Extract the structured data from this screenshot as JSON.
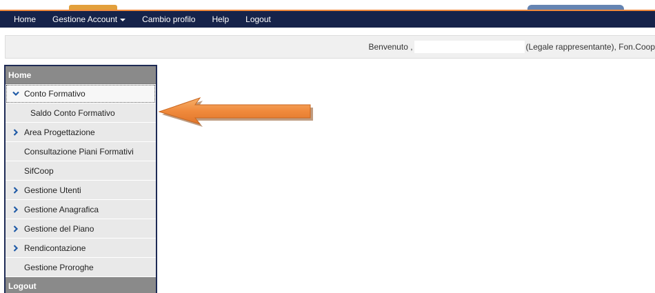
{
  "navbar": {
    "home": "Home",
    "account": "Gestione Account",
    "change_profile": "Cambio profilo",
    "help": "Help",
    "logout": "Logout"
  },
  "welcome": {
    "prefix": "Benvenuto ,",
    "suffix": "(Legale rappresentante), Fon.Coop"
  },
  "sidebar": {
    "home_header": "Home",
    "items": [
      {
        "label": "Conto Formativo",
        "expanded": true
      },
      {
        "label": "Saldo Conto Formativo"
      },
      {
        "label": "Area Progettazione"
      },
      {
        "label": "Consultazione Piani Formativi"
      },
      {
        "label": "SifCoop"
      },
      {
        "label": "Gestione Utenti"
      },
      {
        "label": "Gestione Anagrafica"
      },
      {
        "label": "Gestione del Piano"
      },
      {
        "label": "Rendicontazione"
      },
      {
        "label": "Gestione Proroghe"
      }
    ],
    "logout_header": "Logout"
  },
  "colors": {
    "navbar_bg": "#16234a",
    "accent_orange": "#f0883a",
    "chevron_blue": "#1f5aa6",
    "sidebar_header": "#8a8a8a"
  }
}
